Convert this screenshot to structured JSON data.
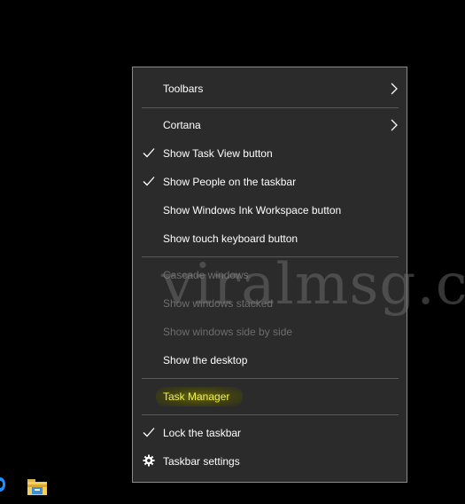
{
  "context_menu": {
    "items": [
      {
        "label": "Toolbars",
        "checked": false,
        "submenu": true,
        "enabled": true
      },
      {
        "label": "Cortana",
        "checked": false,
        "submenu": true,
        "enabled": true
      },
      {
        "label": "Show Task View button",
        "checked": true,
        "submenu": false,
        "enabled": true
      },
      {
        "label": "Show People on the taskbar",
        "checked": true,
        "submenu": false,
        "enabled": true
      },
      {
        "label": "Show Windows Ink Workspace button",
        "checked": false,
        "submenu": false,
        "enabled": true
      },
      {
        "label": "Show touch keyboard button",
        "checked": false,
        "submenu": false,
        "enabled": true
      },
      {
        "label": "Cascade windows",
        "checked": false,
        "submenu": false,
        "enabled": false
      },
      {
        "label": "Show windows stacked",
        "checked": false,
        "submenu": false,
        "enabled": false
      },
      {
        "label": "Show windows side by side",
        "checked": false,
        "submenu": false,
        "enabled": false
      },
      {
        "label": "Show the desktop",
        "checked": false,
        "submenu": false,
        "enabled": true
      },
      {
        "label": "Task Manager",
        "checked": false,
        "submenu": false,
        "enabled": true,
        "highlighted": true
      },
      {
        "label": "Lock the taskbar",
        "checked": true,
        "submenu": false,
        "enabled": true
      },
      {
        "label": "Taskbar settings",
        "checked": false,
        "submenu": false,
        "enabled": true,
        "icon": "gear-icon"
      }
    ]
  },
  "watermark": "viralmsg.co",
  "colors": {
    "menu_bg": "#2b2b2b",
    "menu_border": "#8a8a8a",
    "text": "#ffffff",
    "disabled_text": "#6d6d6d",
    "separator": "#5a5a5a",
    "highlight_text": "#f2f24a"
  },
  "taskbar": {
    "icons": [
      "edge-icon",
      "file-explorer-icon"
    ]
  }
}
